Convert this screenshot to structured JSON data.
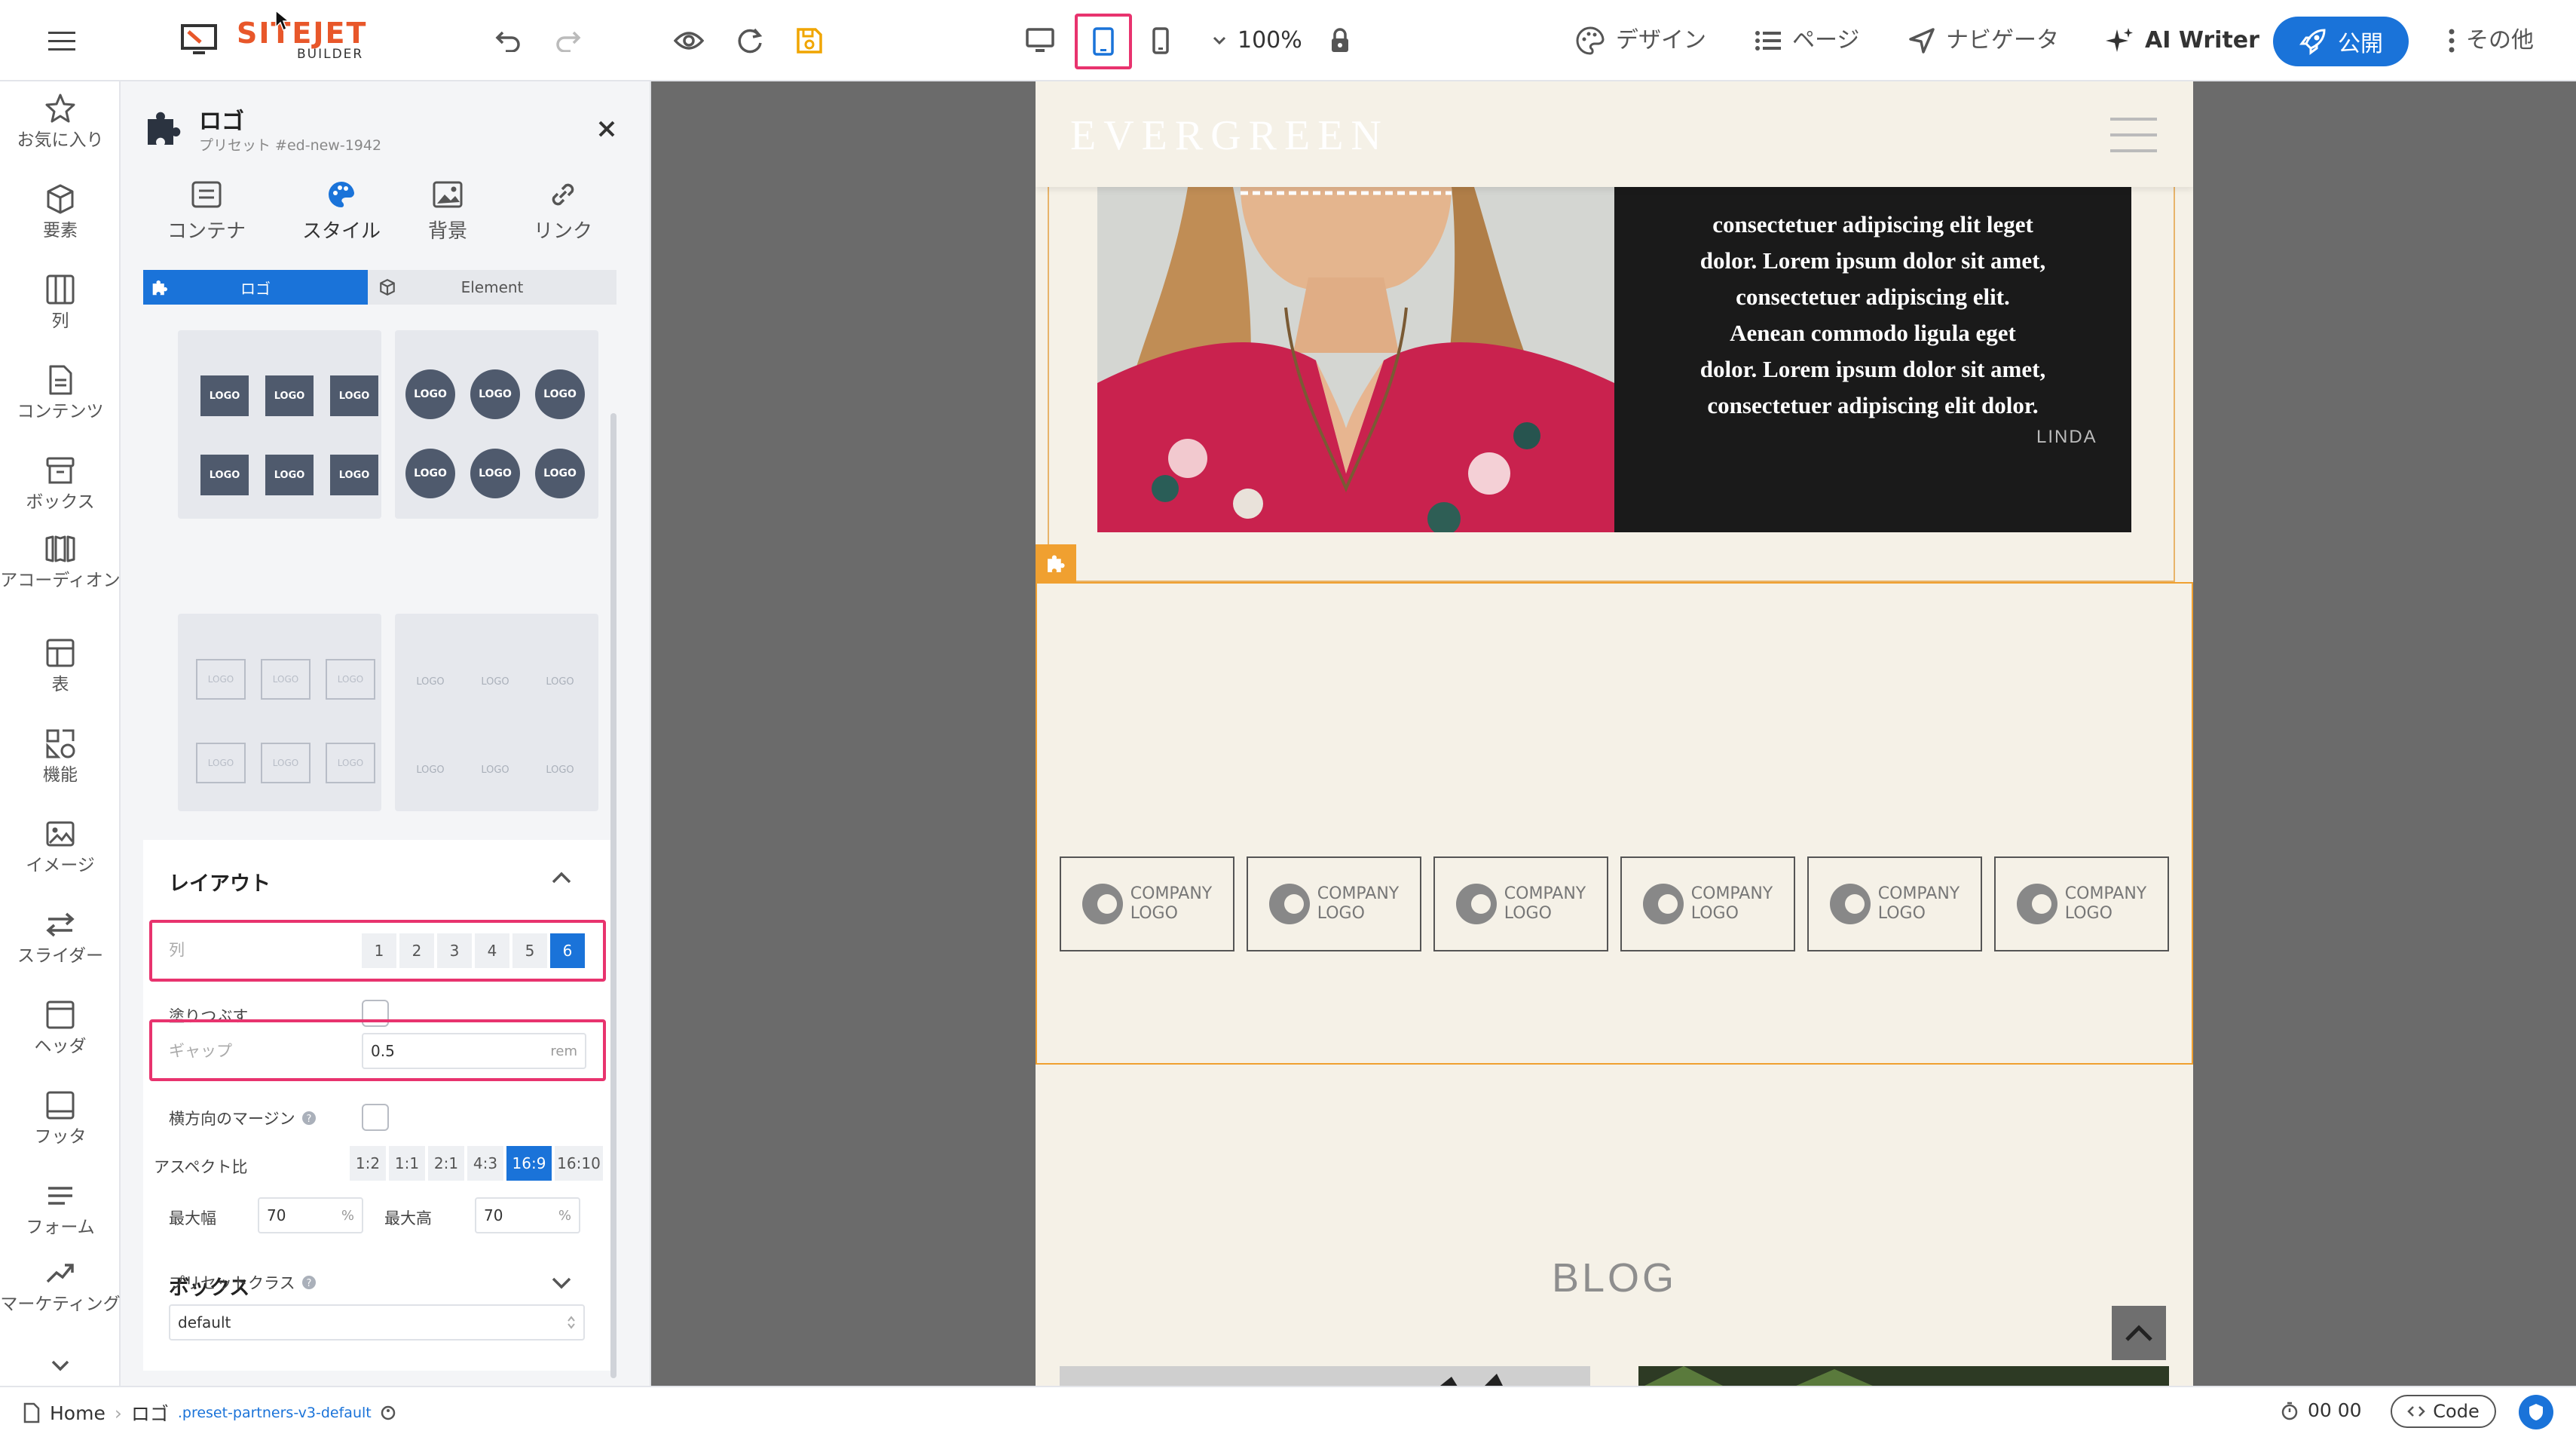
{
  "topbar": {
    "brand": "SITEJET",
    "brand_sub": "BUILDER",
    "zoom": "100%",
    "design": "デザイン",
    "pages": "ページ",
    "navigator": "ナビゲータ",
    "ai_writer": "AI Writer",
    "publish": "公開",
    "more": "その他"
  },
  "rail": {
    "favorites": "お気に入り",
    "elements": "要素",
    "columns": "列",
    "contents": "コンテンツ",
    "box": "ボックス",
    "accordion": "アコーディオン",
    "table": "表",
    "features": "機能",
    "image": "イメージ",
    "slider": "スライダー",
    "header": "ヘッダ",
    "footer": "フッタ",
    "form": "フォーム",
    "marketing": "マーケティング"
  },
  "panel": {
    "title": "ロゴ",
    "subtitle": "プリセット #ed-new-1942",
    "tabs": {
      "content": "コンテナ",
      "style": "スタイル",
      "background": "背景",
      "link": "リンク"
    },
    "switch": {
      "logo": "ロゴ",
      "element": "Element"
    },
    "logo_text": "LOGO",
    "layout": {
      "heading": "レイアウト",
      "columns_label": "列",
      "columns": [
        "1",
        "2",
        "3",
        "4",
        "5",
        "6"
      ],
      "fill_label": "塗りつぶす",
      "gap_label": "ギャップ",
      "gap_value": "0.5",
      "gap_unit": "rem",
      "hmargin_label": "横方向のマージン",
      "aspect_label": "アスペクト比",
      "aspects": [
        "1:2",
        "1:1",
        "2:1",
        "4:3",
        "16:9",
        "16:10"
      ],
      "maxw_label": "最大幅",
      "maxw_value": "70",
      "maxh_label": "最大高",
      "maxh_value": "70",
      "pct": "%"
    },
    "box": {
      "heading": "ボックス",
      "preset_label": "プリセットクラス",
      "preset_value": "default"
    }
  },
  "page": {
    "brand": "EVERGREEN",
    "quote_lines": [
      "consectetuer adipiscing elit leget",
      "dolor. Lorem ipsum dolor sit amet,",
      "consectetuer adipiscing elit.",
      "Aenean commodo ligula eget",
      "dolor. Lorem ipsum dolor sit amet,",
      "consectetuer adipiscing elit dolor."
    ],
    "quote_author": "LINDA",
    "company_logo_line1": "COMPANY",
    "company_logo_line2": "LOGO",
    "blog_heading": "BLOG"
  },
  "statusbar": {
    "home": "Home",
    "crumb_logo": "ロゴ",
    "crumb_class": ".preset-partners-v3-default",
    "timer": "00 00",
    "code": "Code"
  },
  "colors": {
    "accent": "#1a73d9",
    "publish": "#1a73d9",
    "brand_orange": "#e8572a",
    "highlight": "#e8336e",
    "selection": "#f0a030",
    "page_bg": "#f5f1e7"
  }
}
